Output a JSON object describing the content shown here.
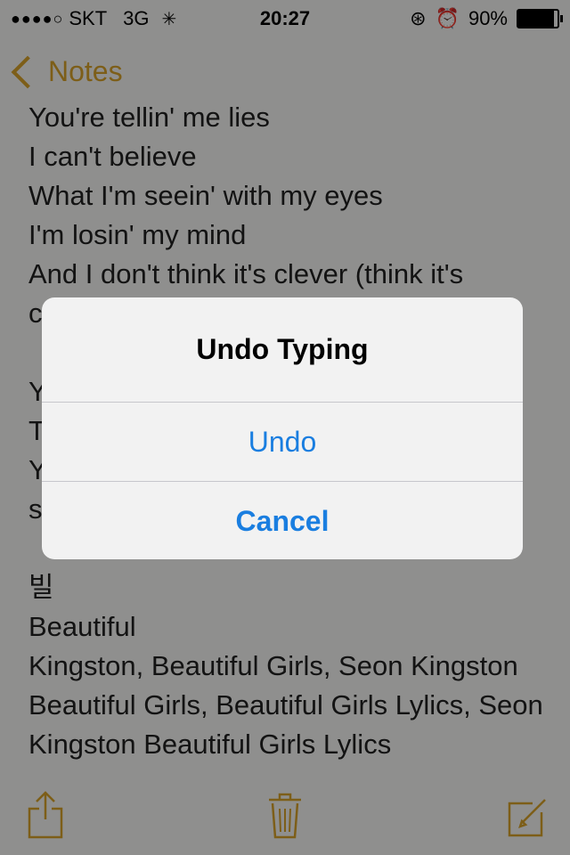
{
  "status_bar": {
    "carrier": "SKT",
    "network": "3G",
    "time": "20:27",
    "battery": "90%",
    "battery_level": 0.9
  },
  "nav": {
    "back_label": "Notes"
  },
  "note": {
    "text": "You're tellin' me lies\nI can't believe\nWhat I'm seein' with my eyes\nI'm losin' my mind\nAnd I don't think it's clever (think it's clever)\n\nYou can't\nThis\nYou\nshe\n\n빌\nBeautiful\nKingston, Beautiful Girls, Seon Kingston Beautiful Girls, Beautiful Girls Lylics, Seon Kingston Beautiful Girls Lylics"
  },
  "alert": {
    "title": "Undo Typing",
    "undo_label": "Undo",
    "cancel_label": "Cancel",
    "accent_color": "#1a7ee0"
  },
  "toolbar": {
    "icons": [
      "share-icon",
      "trash-icon",
      "compose-icon"
    ]
  }
}
